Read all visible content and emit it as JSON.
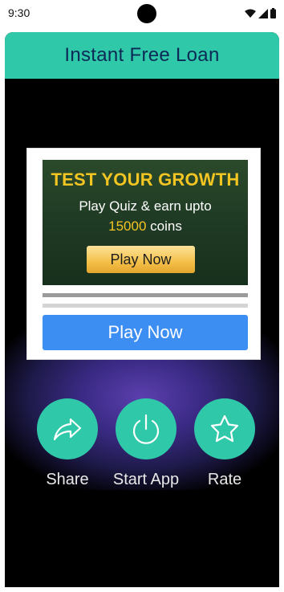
{
  "status_bar": {
    "time": "9:30"
  },
  "header": {
    "title": "Instant Free Loan"
  },
  "ad": {
    "headline": "TEST YOUR GROWTH",
    "subtitle": "Play Quiz & earn upto",
    "coins_value": "15000",
    "coins_unit": "coins",
    "inner_button_label": "Play Now",
    "cta_label": "Play Now"
  },
  "actions": [
    {
      "label": "Share",
      "icon": "share-icon"
    },
    {
      "label": "Start App",
      "icon": "power-icon"
    },
    {
      "label": "Rate",
      "icon": "star-icon"
    }
  ],
  "colors": {
    "accent": "#2fc8a8",
    "header_text": "#0c2a55",
    "cta_blue": "#3d8ef3",
    "ad_gold": "#f3c522"
  }
}
